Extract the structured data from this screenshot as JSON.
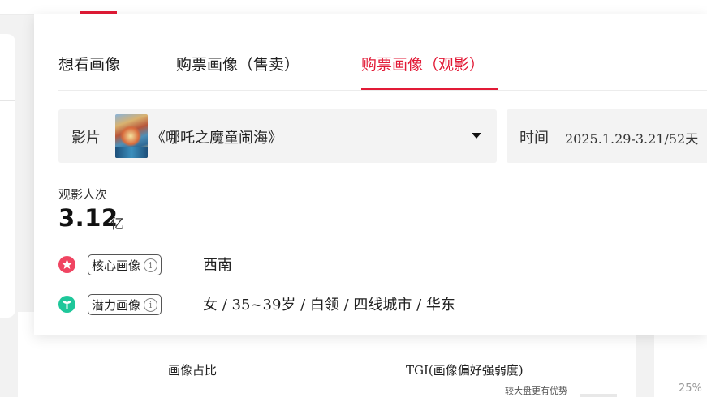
{
  "tabs": [
    {
      "label": "想看画像",
      "active": false
    },
    {
      "label": "购票画像（售卖）",
      "active": false
    },
    {
      "label": "购票画像（观影）",
      "active": true
    }
  ],
  "filters": {
    "film_label": "影片",
    "film_name": "《哪吒之魔童闹海》",
    "time_label": "时间",
    "time_value": "2025.1.29-3.21/52天"
  },
  "metric": {
    "label": "观影人次",
    "value": "3.12",
    "unit": "亿"
  },
  "portraits": {
    "core": {
      "tag": "核心画像",
      "value": "西南",
      "icon": "star-icon"
    },
    "potential": {
      "tag": "潜力画像",
      "value": "女 / 35~39岁 / 白领 / 四线城市 / 华东",
      "icon": "sprout-icon"
    }
  },
  "background": {
    "ratio_label": "画像占比",
    "tgi_label": "TGI(画像偏好强弱度)",
    "tgi_note": "较大盘更有优势",
    "pct": "25%"
  },
  "colors": {
    "accent": "#e21a36",
    "core_icon": "#f04562",
    "potential_icon": "#1ec79a"
  }
}
